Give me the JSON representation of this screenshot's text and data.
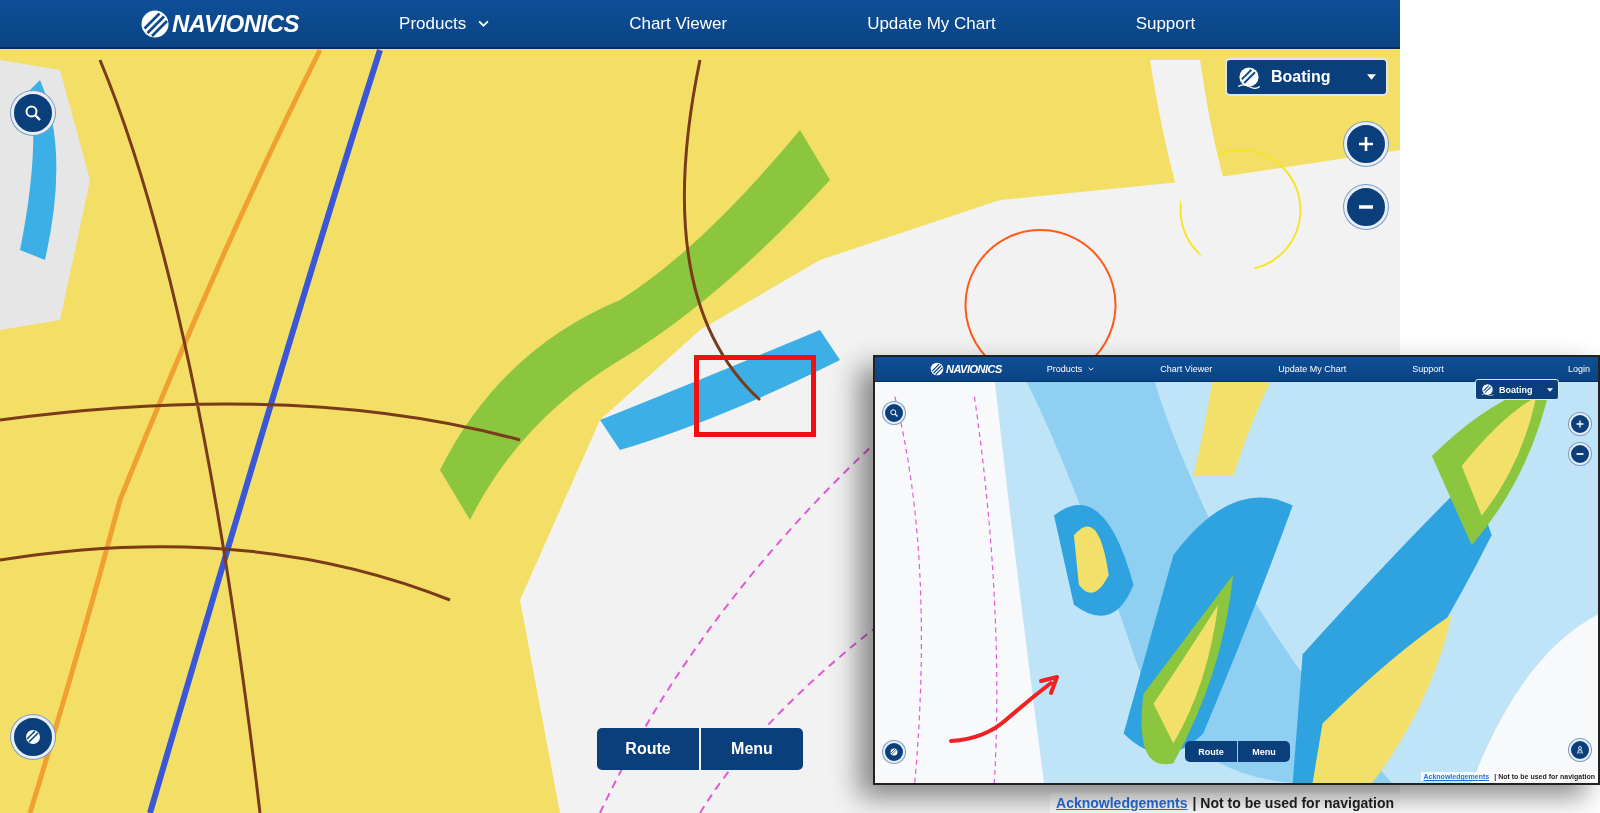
{
  "main": {
    "brand": "NAVIONICS",
    "nav": [
      {
        "label": "Products",
        "kind": "dropdown"
      },
      {
        "label": "Chart Viewer",
        "kind": "link"
      },
      {
        "label": "Update My Chart",
        "kind": "link"
      },
      {
        "label": "Support",
        "kind": "link"
      }
    ],
    "mode": "Boating",
    "buttons": [
      "Route",
      "Menu"
    ],
    "footer": {
      "link": "Acknowledgements",
      "note": "| Not to be used for navigation"
    }
  },
  "inset": {
    "brand": "NAVIONICS",
    "nav": [
      {
        "label": "Products",
        "kind": "dropdown"
      },
      {
        "label": "Chart Viewer",
        "kind": "link"
      },
      {
        "label": "Update My Chart",
        "kind": "link"
      },
      {
        "label": "Support",
        "kind": "link"
      },
      {
        "label": "Login",
        "kind": "login"
      }
    ],
    "mode": "Boating",
    "buttons": [
      "Route",
      "Menu"
    ],
    "footer": {
      "link": "Acknowledgements",
      "note": "| Not to be used for navigation"
    }
  }
}
